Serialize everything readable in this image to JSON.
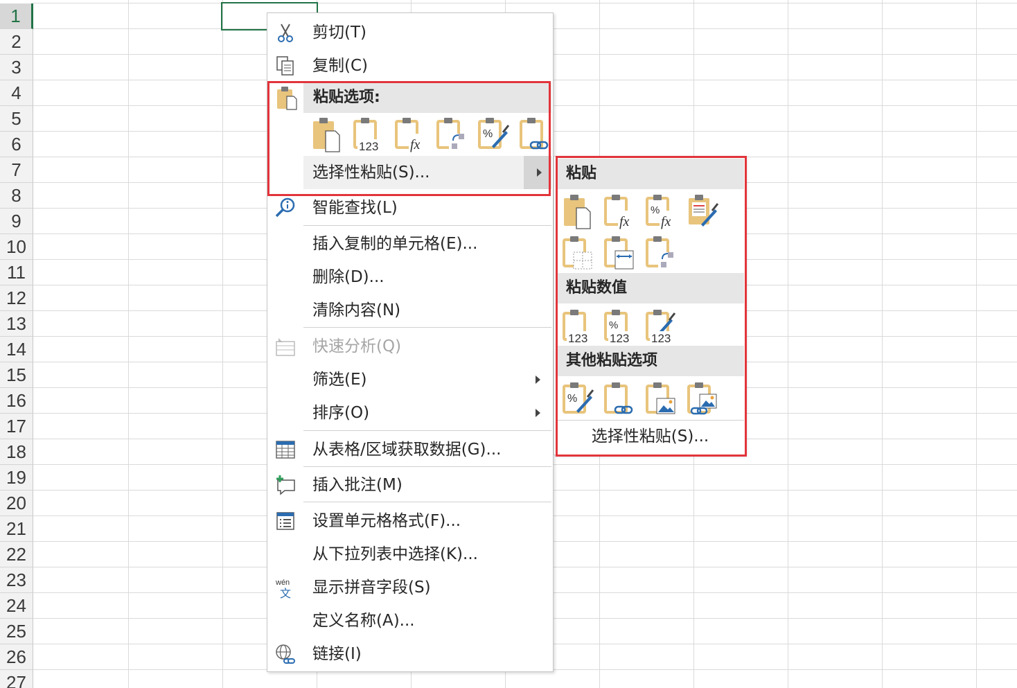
{
  "sheet": {
    "row_numbers": [
      "1",
      "2",
      "3",
      "4",
      "5",
      "6",
      "7",
      "8",
      "9",
      "10",
      "11",
      "12",
      "13",
      "14",
      "15",
      "16",
      "17",
      "18",
      "19",
      "20",
      "21",
      "22",
      "23",
      "24",
      "25",
      "26",
      "27"
    ],
    "active_row": "1"
  },
  "menu": {
    "cut": "剪切(T)",
    "copy": "复制(C)",
    "paste_options_header": "粘贴选项:",
    "paste_special": "选择性粘贴(S)...",
    "smart_lookup": "智能查找(L)",
    "insert_copied_cells": "插入复制的单元格(E)...",
    "delete": "删除(D)...",
    "clear_contents": "清除内容(N)",
    "quick_analysis": "快速分析(Q)",
    "filter": "筛选(E)",
    "sort": "排序(O)",
    "get_data_from_table": "从表格/区域获取数据(G)...",
    "insert_comment": "插入批注(M)",
    "format_cells": "设置单元格格式(F)...",
    "pick_from_dropdown": "从下拉列表中选择(K)...",
    "show_phonetic": "显示拼音字段(S)",
    "define_name": "定义名称(A)...",
    "link": "链接(I)",
    "phonetic_icon_top": "wén",
    "phonetic_icon_bottom": "文"
  },
  "paste_icons": {
    "values_text": "123",
    "percent": "%",
    "fx": "fx"
  },
  "submenu": {
    "paste_header": "粘贴",
    "paste_values_header": "粘贴数值",
    "other_paste_header": "其他粘贴选项",
    "paste_special": "选择性粘贴(S)..."
  },
  "colors": {
    "accent_green": "#217346",
    "highlight_red": "#e2343b",
    "clipboard_tan": "#e8c47c"
  }
}
